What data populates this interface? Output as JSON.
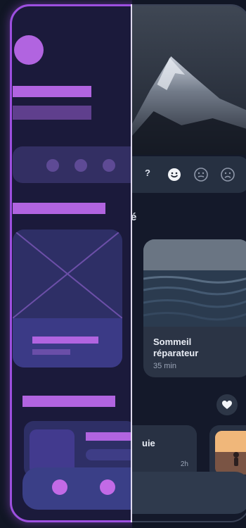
{
  "mood": {
    "question_fragment": "?",
    "emojis": [
      "happy-face-icon",
      "neutral-face-icon",
      "sad-face-icon"
    ]
  },
  "section": {
    "title_fragment": "é"
  },
  "card": {
    "title": "Sommeil réparateur",
    "duration": "35 min"
  },
  "list_item": {
    "title_fragment": "uie",
    "time": "2h"
  },
  "colors": {
    "wireframe_accent": "#b164e0",
    "wireframe_border": "#9d4fe0",
    "real_background": "#14192a"
  }
}
